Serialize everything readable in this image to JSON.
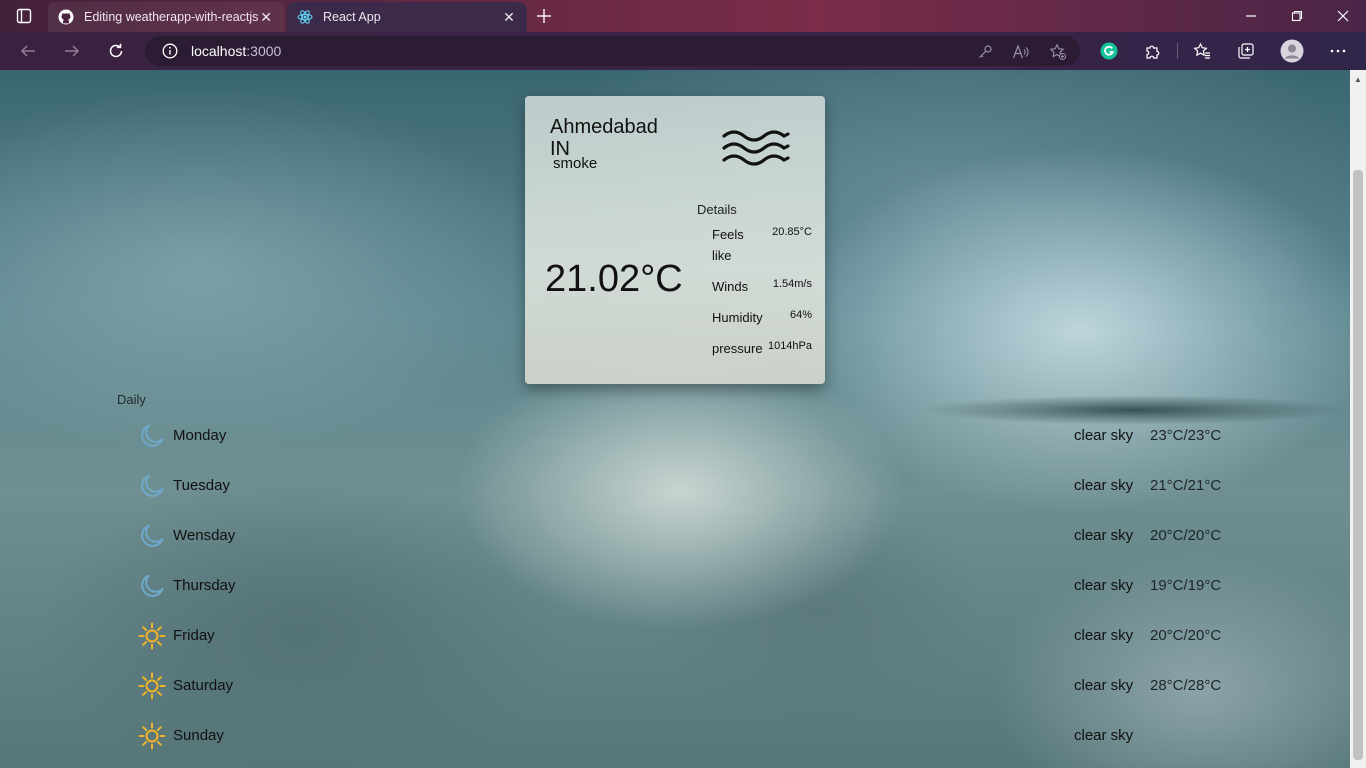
{
  "browser": {
    "tabs": [
      {
        "title": "Editing weatherapp-with-reactjs/",
        "favicon": "github-icon",
        "active": false
      },
      {
        "title": "React App",
        "favicon": "react-icon",
        "active": true
      }
    ],
    "address": {
      "host": "localhost",
      "port": ":3000"
    }
  },
  "weather": {
    "city": "Ahmedabad",
    "country": "IN",
    "condition": "smoke",
    "condition_icon": "haze-icon",
    "temperature": "21.02°C",
    "details_title": "Details",
    "details": [
      {
        "label": "Feels like",
        "value": "20.85°C"
      },
      {
        "label": "Winds",
        "value": "1.54m/s"
      },
      {
        "label": "Humidity",
        "value": "64%"
      },
      {
        "label": "pressure",
        "value": "1014hPa"
      }
    ]
  },
  "daily": {
    "label": "Daily",
    "days": [
      {
        "name": "Monday",
        "icon": "moon-icon",
        "desc": "clear sky",
        "range": "23°C/23°C"
      },
      {
        "name": "Tuesday",
        "icon": "moon-icon",
        "desc": "clear sky",
        "range": "21°C/21°C"
      },
      {
        "name": "Wensday",
        "icon": "moon-icon",
        "desc": "clear sky",
        "range": "20°C/20°C"
      },
      {
        "name": "Thursday",
        "icon": "moon-icon",
        "desc": "clear sky",
        "range": "19°C/19°C"
      },
      {
        "name": "Friday",
        "icon": "sun-icon",
        "desc": "clear sky",
        "range": "20°C/20°C"
      },
      {
        "name": "Saturday",
        "icon": "sun-icon",
        "desc": "clear sky",
        "range": "28°C/28°C"
      },
      {
        "name": "Sunday",
        "icon": "sun-icon",
        "desc": "clear sky",
        "range": ""
      }
    ]
  },
  "colors": {
    "moon": "#6fa8c9",
    "sun": "#f0b429"
  }
}
